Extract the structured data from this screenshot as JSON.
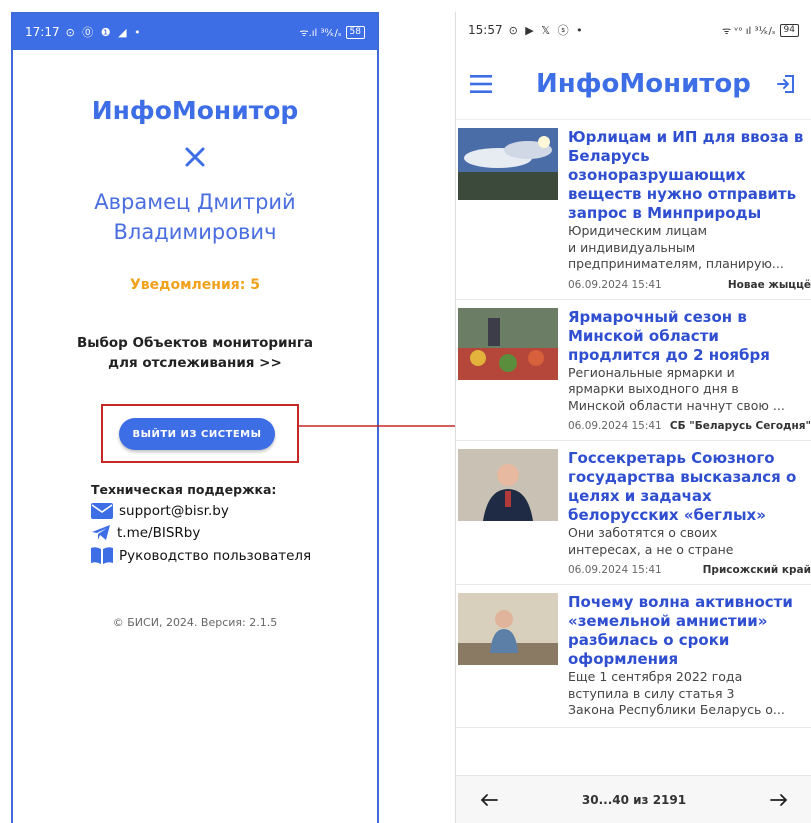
{
  "left": {
    "status": {
      "time": "17:17",
      "icons": "⊙ ⓪ ❶ ◢ •",
      "signal": "ᯤ.ıl ³⁰⁄ₖ/ₛ",
      "battery": "58"
    },
    "app_title": "ИнфоМонитор",
    "user_name": [
      "Аврамец Дмитрий",
      "Владимирович"
    ],
    "notifications": "Уведомления: 5",
    "monitoring_link": [
      "Выбор Объектов мониторинга",
      "для отслеживания >>"
    ],
    "logout_label": "ВЫЙТИ ИЗ СИСТЕМЫ",
    "support": {
      "title": "Техническая поддержка:",
      "email": "support@bisr.by",
      "telegram": "t.me/BISRby",
      "manual": "Руководство пользователя"
    },
    "copyright": "© БИСИ, 2024. Версия: 2.1.5",
    "accent_color": "#3d6ee6"
  },
  "right": {
    "status": {
      "time": "15:57",
      "icons": "⊙ ▶ 𝕏 ⓢ •",
      "signal": "ᯤ ᵛᵒ ıl ³¹⁄ₖ/ₛ",
      "battery": "94"
    },
    "app_title": "ИнфоМонитор",
    "news": [
      {
        "title": "Юрлицам и ИП для ввоза в Беларусь озоноразрушающих веществ нужно отправить запрос в Минприроды",
        "body": [
          "Юридическим лицам",
          "и индивидуальным",
          "предпринимателям, планирую..."
        ],
        "date": "06.09.2024 15:41",
        "source": "Новае жыццё"
      },
      {
        "title": "Ярмарочный сезон в Минской области продлится до 2 ноября",
        "body": [
          "Региональные ярмарки и",
          "ярмарки выходного дня в",
          "Минской области начнут свою ..."
        ],
        "date": "06.09.2024 15:41",
        "source": "СБ \"Беларусь Сегодня\""
      },
      {
        "title": "Госсекретарь Союзного государства высказался о целях и задачах белорусских «беглых»",
        "body": [
          "Они заботятся о своих",
          "интересах, а не о стране"
        ],
        "date": "06.09.2024 15:41",
        "source": "Присожский край"
      },
      {
        "title": "Почему волна активности «земельной амнистии» разбилась о сроки оформления",
        "body": [
          "Еще 1 сентября 2022 года",
          "вступила в силу статья 3",
          "Закона Республики Беларусь о..."
        ],
        "date": "",
        "source": ""
      }
    ],
    "pager": {
      "range": "30...40 из 2191"
    }
  }
}
